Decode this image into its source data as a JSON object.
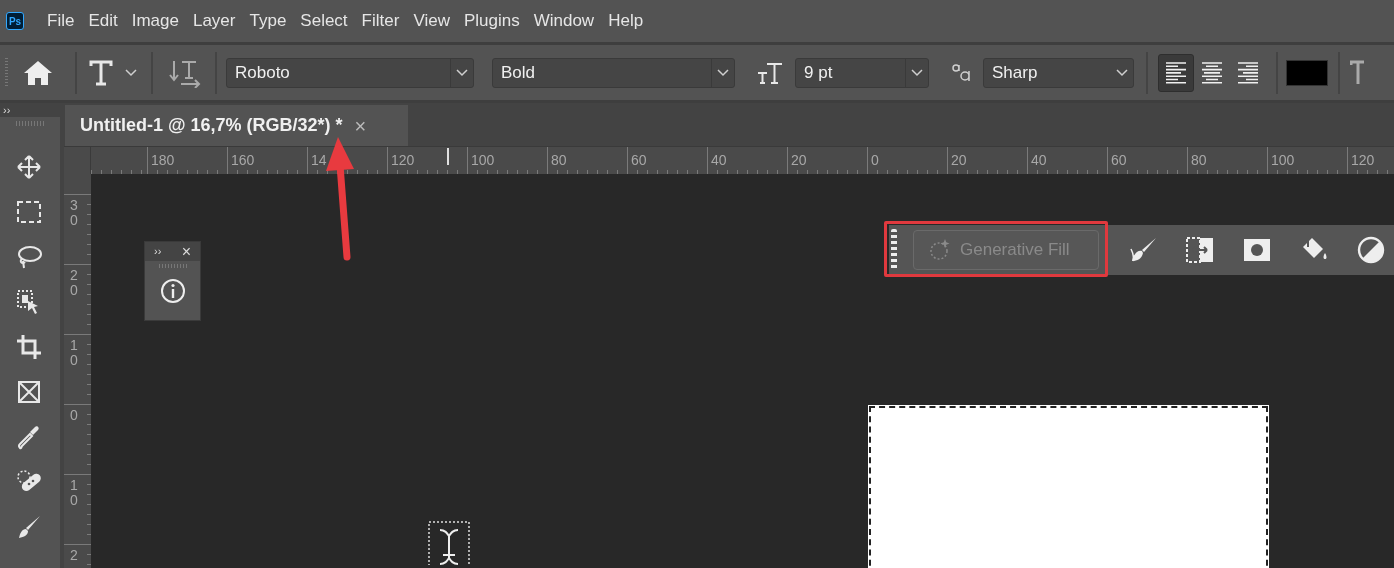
{
  "menu": {
    "app_logo": "Ps",
    "items": [
      "File",
      "Edit",
      "Image",
      "Layer",
      "Type",
      "Select",
      "Filter",
      "View",
      "Plugins",
      "Window",
      "Help"
    ]
  },
  "options_bar": {
    "font_family": "Roboto",
    "font_style": "Bold",
    "font_size": "9 pt",
    "antialiasing": "Sharp",
    "alignment": [
      {
        "kind": "left",
        "selected": true
      },
      {
        "kind": "center",
        "selected": false
      },
      {
        "kind": "right",
        "selected": false
      }
    ]
  },
  "toolbar": {
    "collapse": "››"
  },
  "document_tab": {
    "title": "Untitled-1 @ 16,7% (RGB/32*) *",
    "close": "×"
  },
  "rulers": {
    "horizontal": [
      "180",
      "160",
      "14",
      "120",
      "100",
      "80",
      "60",
      "40",
      "20",
      "0",
      "20",
      "40",
      "60",
      "80",
      "100",
      "120"
    ],
    "vertical": [
      "30",
      "20",
      "10",
      "0",
      "10",
      "2"
    ]
  },
  "info_panel": {
    "collapse": "››",
    "close": "×"
  },
  "contextual_taskbar": {
    "generative_fill": {
      "label": "Generative Fill",
      "disabled": true
    }
  }
}
